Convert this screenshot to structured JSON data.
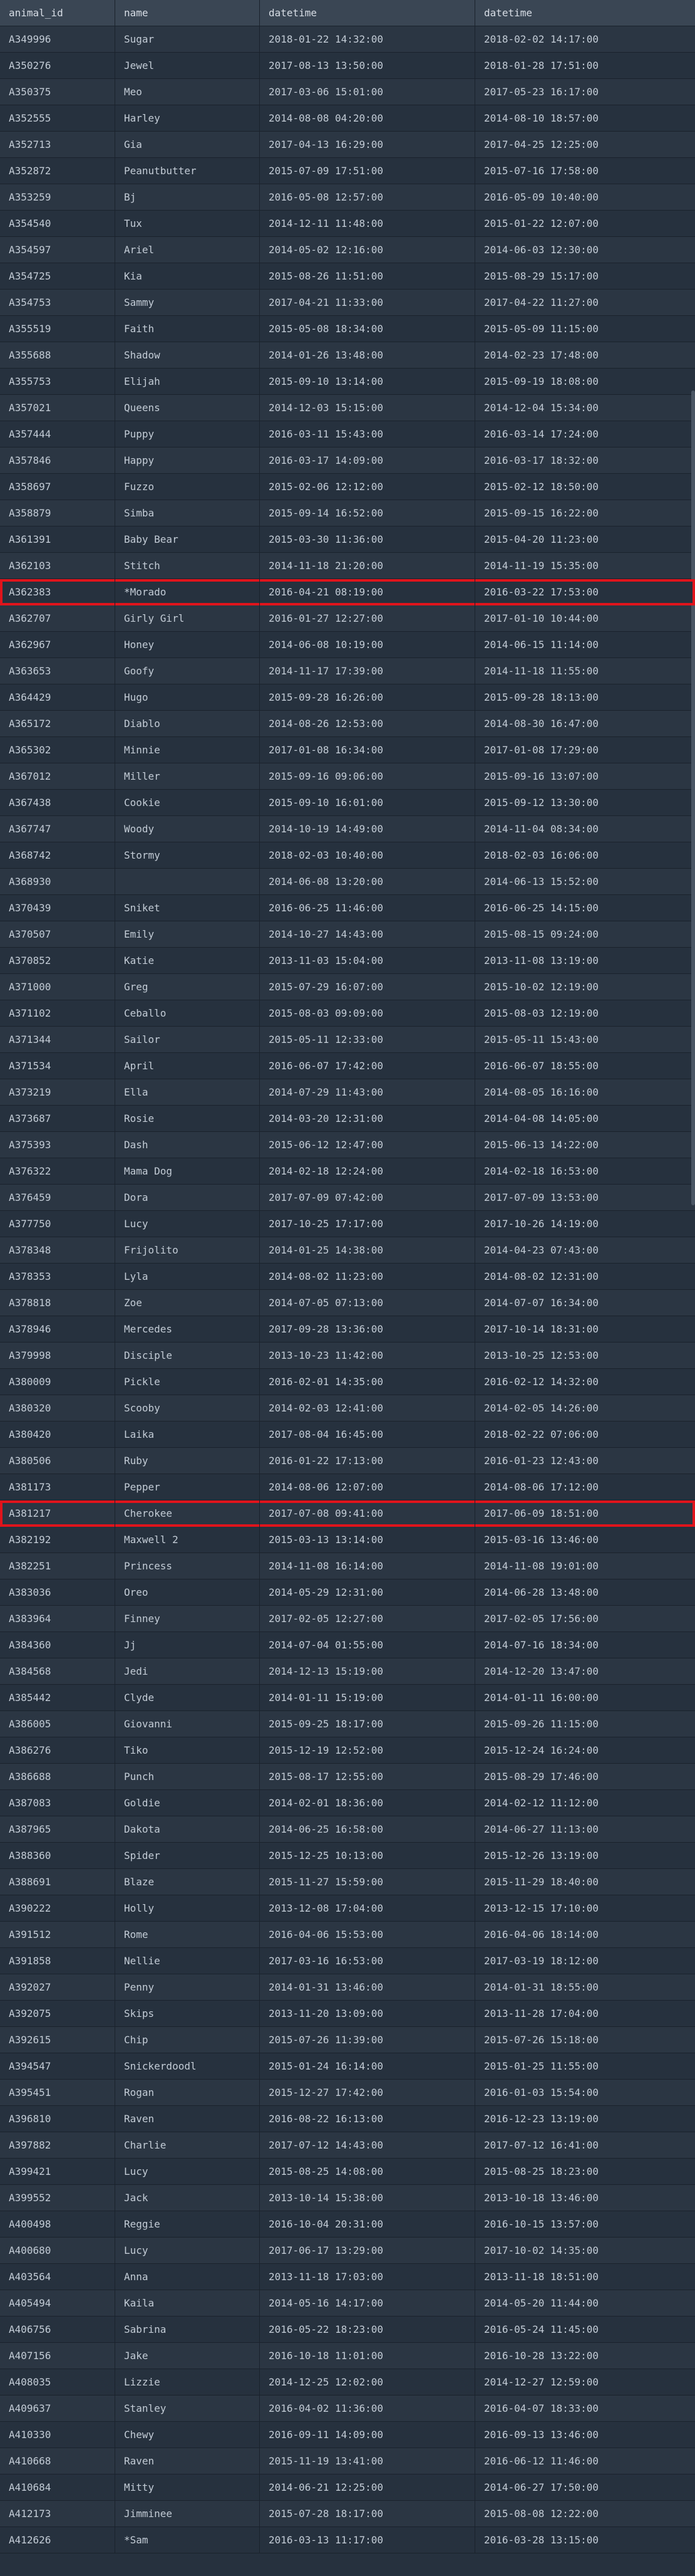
{
  "grid": {
    "columns": [
      "animal_id",
      "name",
      "datetime",
      "datetime"
    ],
    "rows": [
      [
        "A349996",
        "Sugar",
        "2018-01-22 14:32:00",
        "2018-02-02 14:17:00"
      ],
      [
        "A350276",
        "Jewel",
        "2017-08-13 13:50:00",
        "2018-01-28 17:51:00"
      ],
      [
        "A350375",
        "Meo",
        "2017-03-06 15:01:00",
        "2017-05-23 16:17:00"
      ],
      [
        "A352555",
        "Harley",
        "2014-08-08 04:20:00",
        "2014-08-10 18:57:00"
      ],
      [
        "A352713",
        "Gia",
        "2017-04-13 16:29:00",
        "2017-04-25 12:25:00"
      ],
      [
        "A352872",
        "Peanutbutter",
        "2015-07-09 17:51:00",
        "2015-07-16 17:58:00"
      ],
      [
        "A353259",
        "Bj",
        "2016-05-08 12:57:00",
        "2016-05-09 10:40:00"
      ],
      [
        "A354540",
        "Tux",
        "2014-12-11 11:48:00",
        "2015-01-22 12:07:00"
      ],
      [
        "A354597",
        "Ariel",
        "2014-05-02 12:16:00",
        "2014-06-03 12:30:00"
      ],
      [
        "A354725",
        "Kia",
        "2015-08-26 11:51:00",
        "2015-08-29 15:17:00"
      ],
      [
        "A354753",
        "Sammy",
        "2017-04-21 11:33:00",
        "2017-04-22 11:27:00"
      ],
      [
        "A355519",
        "Faith",
        "2015-05-08 18:34:00",
        "2015-05-09 11:15:00"
      ],
      [
        "A355688",
        "Shadow",
        "2014-01-26 13:48:00",
        "2014-02-23 17:48:00"
      ],
      [
        "A355753",
        "Elijah",
        "2015-09-10 13:14:00",
        "2015-09-19 18:08:00"
      ],
      [
        "A357021",
        "Queens",
        "2014-12-03 15:15:00",
        "2014-12-04 15:34:00"
      ],
      [
        "A357444",
        "Puppy",
        "2016-03-11 15:43:00",
        "2016-03-14 17:24:00"
      ],
      [
        "A357846",
        "Happy",
        "2016-03-17 14:09:00",
        "2016-03-17 18:32:00"
      ],
      [
        "A358697",
        "Fuzzo",
        "2015-02-06 12:12:00",
        "2015-02-12 18:50:00"
      ],
      [
        "A358879",
        "Simba",
        "2015-09-14 16:52:00",
        "2015-09-15 16:22:00"
      ],
      [
        "A361391",
        "Baby Bear",
        "2015-03-30 11:36:00",
        "2015-04-20 11:23:00"
      ],
      [
        "A362103",
        "Stitch",
        "2014-11-18 21:20:00",
        "2014-11-19 15:35:00"
      ],
      [
        "A362383",
        "*Morado",
        "2016-04-21 08:19:00",
        "2016-03-22 17:53:00"
      ],
      [
        "A362707",
        "Girly Girl",
        "2016-01-27 12:27:00",
        "2017-01-10 10:44:00"
      ],
      [
        "A362967",
        "Honey",
        "2014-06-08 10:19:00",
        "2014-06-15 11:14:00"
      ],
      [
        "A363653",
        "Goofy",
        "2014-11-17 17:39:00",
        "2014-11-18 11:55:00"
      ],
      [
        "A364429",
        "Hugo",
        "2015-09-28 16:26:00",
        "2015-09-28 18:13:00"
      ],
      [
        "A365172",
        "Diablo",
        "2014-08-26 12:53:00",
        "2014-08-30 16:47:00"
      ],
      [
        "A365302",
        "Minnie",
        "2017-01-08 16:34:00",
        "2017-01-08 17:29:00"
      ],
      [
        "A367012",
        "Miller",
        "2015-09-16 09:06:00",
        "2015-09-16 13:07:00"
      ],
      [
        "A367438",
        "Cookie",
        "2015-09-10 16:01:00",
        "2015-09-12 13:30:00"
      ],
      [
        "A367747",
        "Woody",
        "2014-10-19 14:49:00",
        "2014-11-04 08:34:00"
      ],
      [
        "A368742",
        "Stormy",
        "2018-02-03 10:40:00",
        "2018-02-03 16:06:00"
      ],
      [
        "A368930",
        "",
        "2014-06-08 13:20:00",
        "2014-06-13 15:52:00"
      ],
      [
        "A370439",
        "Sniket",
        "2016-06-25 11:46:00",
        "2016-06-25 14:15:00"
      ],
      [
        "A370507",
        "Emily",
        "2014-10-27 14:43:00",
        "2015-08-15 09:24:00"
      ],
      [
        "A370852",
        "Katie",
        "2013-11-03 15:04:00",
        "2013-11-08 13:19:00"
      ],
      [
        "A371000",
        "Greg",
        "2015-07-29 16:07:00",
        "2015-10-02 12:19:00"
      ],
      [
        "A371102",
        "Ceballo",
        "2015-08-03 09:09:00",
        "2015-08-03 12:19:00"
      ],
      [
        "A371344",
        "Sailor",
        "2015-05-11 12:33:00",
        "2015-05-11 15:43:00"
      ],
      [
        "A371534",
        "April",
        "2016-06-07 17:42:00",
        "2016-06-07 18:55:00"
      ],
      [
        "A373219",
        "Ella",
        "2014-07-29 11:43:00",
        "2014-08-05 16:16:00"
      ],
      [
        "A373687",
        "Rosie",
        "2014-03-20 12:31:00",
        "2014-04-08 14:05:00"
      ],
      [
        "A375393",
        "Dash",
        "2015-06-12 12:47:00",
        "2015-06-13 14:22:00"
      ],
      [
        "A376322",
        "Mama Dog",
        "2014-02-18 12:24:00",
        "2014-02-18 16:53:00"
      ],
      [
        "A376459",
        "Dora",
        "2017-07-09 07:42:00",
        "2017-07-09 13:53:00"
      ],
      [
        "A377750",
        "Lucy",
        "2017-10-25 17:17:00",
        "2017-10-26 14:19:00"
      ],
      [
        "A378348",
        "Frijolito",
        "2014-01-25 14:38:00",
        "2014-04-23 07:43:00"
      ],
      [
        "A378353",
        "Lyla",
        "2014-08-02 11:23:00",
        "2014-08-02 12:31:00"
      ],
      [
        "A378818",
        "Zoe",
        "2014-07-05 07:13:00",
        "2014-07-07 16:34:00"
      ],
      [
        "A378946",
        "Mercedes",
        "2017-09-28 13:36:00",
        "2017-10-14 18:31:00"
      ],
      [
        "A379998",
        "Disciple",
        "2013-10-23 11:42:00",
        "2013-10-25 12:53:00"
      ],
      [
        "A380009",
        "Pickle",
        "2016-02-01 14:35:00",
        "2016-02-12 14:32:00"
      ],
      [
        "A380320",
        "Scooby",
        "2014-02-03 12:41:00",
        "2014-02-05 14:26:00"
      ],
      [
        "A380420",
        "Laika",
        "2017-08-04 16:45:00",
        "2018-02-22 07:06:00"
      ],
      [
        "A380506",
        "Ruby",
        "2016-01-22 17:13:00",
        "2016-01-23 12:43:00"
      ],
      [
        "A381173",
        "Pepper",
        "2014-08-06 12:07:00",
        "2014-08-06 17:12:00"
      ],
      [
        "A381217",
        "Cherokee",
        "2017-07-08 09:41:00",
        "2017-06-09 18:51:00"
      ],
      [
        "A382192",
        "Maxwell 2",
        "2015-03-13 13:14:00",
        "2015-03-16 13:46:00"
      ],
      [
        "A382251",
        "Princess",
        "2014-11-08 16:14:00",
        "2014-11-08 19:01:00"
      ],
      [
        "A383036",
        "Oreo",
        "2014-05-29 12:31:00",
        "2014-06-28 13:48:00"
      ],
      [
        "A383964",
        "Finney",
        "2017-02-05 12:27:00",
        "2017-02-05 17:56:00"
      ],
      [
        "A384360",
        "Jj",
        "2014-07-04 01:55:00",
        "2014-07-16 18:34:00"
      ],
      [
        "A384568",
        "Jedi",
        "2014-12-13 15:19:00",
        "2014-12-20 13:47:00"
      ],
      [
        "A385442",
        "Clyde",
        "2014-01-11 15:19:00",
        "2014-01-11 16:00:00"
      ],
      [
        "A386005",
        "Giovanni",
        "2015-09-25 18:17:00",
        "2015-09-26 11:15:00"
      ],
      [
        "A386276",
        "Tiko",
        "2015-12-19 12:52:00",
        "2015-12-24 16:24:00"
      ],
      [
        "A386688",
        "Punch",
        "2015-08-17 12:55:00",
        "2015-08-29 17:46:00"
      ],
      [
        "A387083",
        "Goldie",
        "2014-02-01 18:36:00",
        "2014-02-12 11:12:00"
      ],
      [
        "A387965",
        "Dakota",
        "2014-06-25 16:58:00",
        "2014-06-27 11:13:00"
      ],
      [
        "A388360",
        "Spider",
        "2015-12-25 10:13:00",
        "2015-12-26 13:19:00"
      ],
      [
        "A388691",
        "Blaze",
        "2015-11-27 15:59:00",
        "2015-11-29 18:40:00"
      ],
      [
        "A390222",
        "Holly",
        "2013-12-08 17:04:00",
        "2013-12-15 17:10:00"
      ],
      [
        "A391512",
        "Rome",
        "2016-04-06 15:53:00",
        "2016-04-06 18:14:00"
      ],
      [
        "A391858",
        "Nellie",
        "2017-03-16 16:53:00",
        "2017-03-19 18:12:00"
      ],
      [
        "A392027",
        "Penny",
        "2014-01-31 13:46:00",
        "2014-01-31 18:55:00"
      ],
      [
        "A392075",
        "Skips",
        "2013-11-20 13:09:00",
        "2013-11-28 17:04:00"
      ],
      [
        "A392615",
        "Chip",
        "2015-07-26 11:39:00",
        "2015-07-26 15:18:00"
      ],
      [
        "A394547",
        "Snickerdoodl",
        "2015-01-24 16:14:00",
        "2015-01-25 11:55:00"
      ],
      [
        "A395451",
        "Rogan",
        "2015-12-27 17:42:00",
        "2016-01-03 15:54:00"
      ],
      [
        "A396810",
        "Raven",
        "2016-08-22 16:13:00",
        "2016-12-23 13:19:00"
      ],
      [
        "A397882",
        "Charlie",
        "2017-07-12 14:43:00",
        "2017-07-12 16:41:00"
      ],
      [
        "A399421",
        "Lucy",
        "2015-08-25 14:08:00",
        "2015-08-25 18:23:00"
      ],
      [
        "A399552",
        "Jack",
        "2013-10-14 15:38:00",
        "2013-10-18 13:46:00"
      ],
      [
        "A400498",
        "Reggie",
        "2016-10-04 20:31:00",
        "2016-10-15 13:57:00"
      ],
      [
        "A400680",
        "Lucy",
        "2017-06-17 13:29:00",
        "2017-10-02 14:35:00"
      ],
      [
        "A403564",
        "Anna",
        "2013-11-18 17:03:00",
        "2013-11-18 18:51:00"
      ],
      [
        "A405494",
        "Kaila",
        "2014-05-16 14:17:00",
        "2014-05-20 11:44:00"
      ],
      [
        "A406756",
        "Sabrina",
        "2016-05-22 18:23:00",
        "2016-05-24 11:45:00"
      ],
      [
        "A407156",
        "Jake",
        "2016-10-18 11:01:00",
        "2016-10-28 13:22:00"
      ],
      [
        "A408035",
        "Lizzie",
        "2014-12-25 12:02:00",
        "2014-12-27 12:59:00"
      ],
      [
        "A409637",
        "Stanley",
        "2016-04-02 11:36:00",
        "2016-04-07 18:33:00"
      ],
      [
        "A410330",
        "Chewy",
        "2016-09-11 14:09:00",
        "2016-09-13 13:46:00"
      ],
      [
        "A410668",
        "Raven",
        "2015-11-19 13:41:00",
        "2016-06-12 11:46:00"
      ],
      [
        "A410684",
        "Mitty",
        "2014-06-21 12:25:00",
        "2014-06-27 17:50:00"
      ],
      [
        "A412173",
        "Jimminee",
        "2015-07-28 18:17:00",
        "2015-08-08 12:22:00"
      ],
      [
        "A412626",
        "*Sam",
        "2016-03-13 11:17:00",
        "2016-03-28 13:15:00"
      ]
    ],
    "selected_rows": [
      21,
      56
    ]
  }
}
